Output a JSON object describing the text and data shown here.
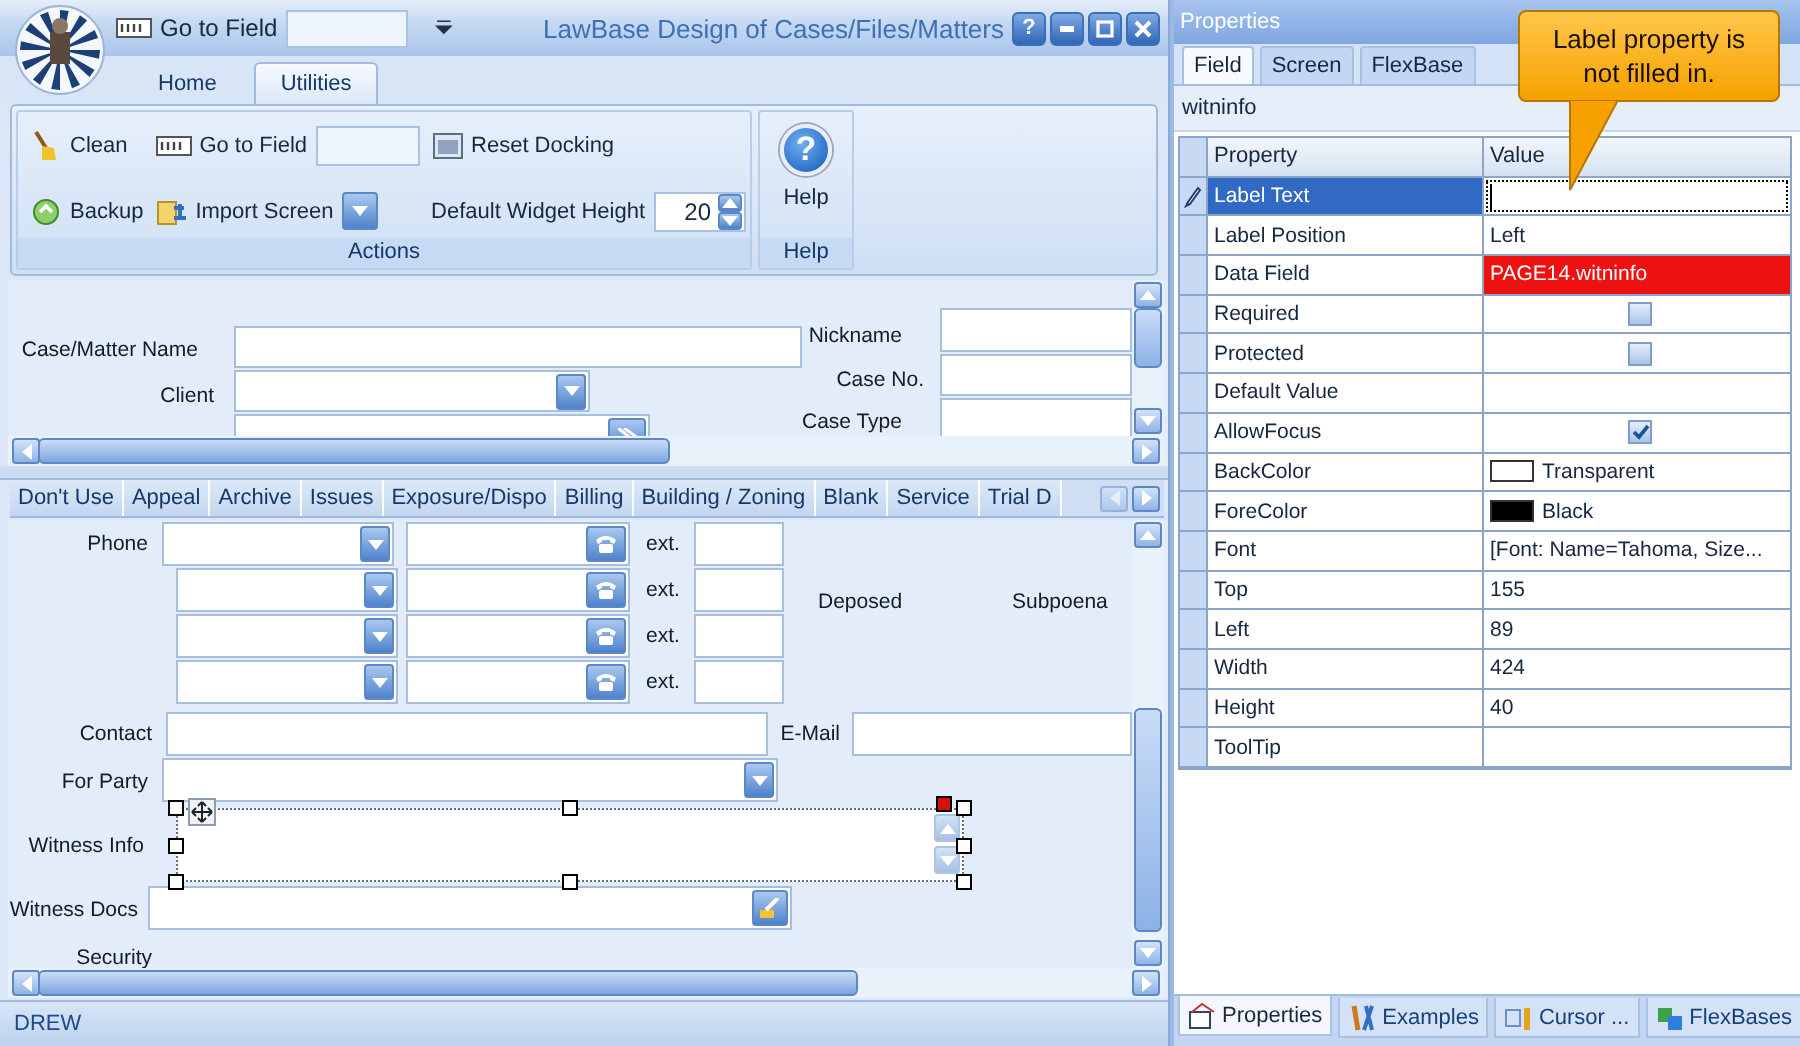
{
  "window": {
    "title": "LawBase Design of Cases/Files/Matters",
    "help_button": "?"
  },
  "quick_access": {
    "label": "Go to Field"
  },
  "ribbon": {
    "tabs": [
      {
        "label": "Home",
        "selected": false
      },
      {
        "label": "Utilities",
        "selected": true
      }
    ],
    "actions": {
      "clean": "Clean",
      "backup": "Backup",
      "go_to_field": "Go to Field",
      "import_screen": "Import Screen",
      "reset_docking": "Reset Docking",
      "widget_height_label": "Default Widget Height",
      "widget_height_value": "20"
    },
    "groups": [
      "Actions",
      "Help"
    ],
    "help": {
      "glyph": "?",
      "label": "Help"
    }
  },
  "case_form": {
    "fields": [
      {
        "label": "Case/Matter Name",
        "kind": "text",
        "selected": false
      },
      {
        "label": "Client",
        "kind": "dropdown",
        "selected": false
      },
      {
        "kind": "lookup",
        "selected": false
      },
      {
        "label": "Nickname",
        "kind": "text",
        "selected": false
      },
      {
        "label": "Case No.",
        "kind": "text",
        "selected": false
      },
      {
        "label": "Case Type",
        "kind": "text",
        "selected": false
      }
    ]
  },
  "section_tabs": [
    {
      "label": "Don't Use",
      "selected": false
    },
    {
      "label": "Appeal",
      "selected": false
    },
    {
      "label": "Archive",
      "selected": false
    },
    {
      "label": "Issues",
      "selected": false
    },
    {
      "label": "Exposure/Dispo",
      "selected": false
    },
    {
      "label": "Billing",
      "selected": false
    },
    {
      "label": "Building / Zoning",
      "selected": false
    },
    {
      "label": "Blank",
      "selected": false
    },
    {
      "label": "Service",
      "selected": false
    },
    {
      "label": "Trial D",
      "selected": false
    }
  ],
  "contact_form": {
    "phones": [
      {
        "label": "Phone",
        "ext_label": "ext."
      },
      {
        "ext_label": "ext."
      },
      {
        "ext_label": "ext."
      },
      {
        "ext_label": "ext."
      }
    ],
    "flags": [
      "Deposed",
      "Subpoena"
    ],
    "fields": [
      {
        "label": "Contact",
        "kind": "text",
        "selected": false
      },
      {
        "label": "E-Mail",
        "kind": "text",
        "selected": false
      },
      {
        "label": "For Party",
        "kind": "dropdown",
        "selected": false
      },
      {
        "label": "Witness Info",
        "kind": "memo",
        "selected": true
      },
      {
        "label": "Witness Docs",
        "kind": "docs",
        "selected": false
      },
      {
        "label": "Security",
        "kind": "label",
        "selected": false
      }
    ]
  },
  "status_bar": {
    "user": "DREW"
  },
  "properties": {
    "title": "Properties",
    "tabs": [
      {
        "label": "Field",
        "selected": true
      },
      {
        "label": "Screen",
        "selected": false
      },
      {
        "label": "FlexBase",
        "selected": false
      }
    ],
    "object": "witninfo",
    "columns": [
      "Property",
      "Value"
    ],
    "rows": [
      {
        "name": "Label Text",
        "kind": "text",
        "selected": true,
        "invalid": false
      },
      {
        "name": "Label Position",
        "kind": "text",
        "value": "Left",
        "selected": false,
        "invalid": false
      },
      {
        "name": "Data Field",
        "kind": "text",
        "value": "PAGE14.witninfo",
        "selected": false,
        "invalid": true
      },
      {
        "name": "Required",
        "kind": "checkbox",
        "checked": false,
        "selected": false,
        "invalid": false
      },
      {
        "name": "Protected",
        "kind": "checkbox",
        "checked": false,
        "selected": false,
        "invalid": false
      },
      {
        "name": "Default Value",
        "kind": "text",
        "selected": false,
        "invalid": false
      },
      {
        "name": "AllowFocus",
        "kind": "checkbox",
        "checked": true,
        "selected": false,
        "invalid": false
      },
      {
        "name": "BackColor",
        "kind": "color",
        "color": "#ffffff",
        "value": "Transparent",
        "selected": false,
        "invalid": false
      },
      {
        "name": "ForeColor",
        "kind": "color",
        "color": "#000000",
        "value": "Black",
        "selected": false,
        "invalid": false
      },
      {
        "name": "Font",
        "kind": "text",
        "value": "[Font: Name=Tahoma, Size...",
        "selected": false,
        "invalid": false
      },
      {
        "name": "Top",
        "kind": "text",
        "value": "155",
        "selected": false,
        "invalid": false
      },
      {
        "name": "Left",
        "kind": "text",
        "value": "89",
        "selected": false,
        "invalid": false
      },
      {
        "name": "Width",
        "kind": "text",
        "value": "424",
        "selected": false,
        "invalid": false
      },
      {
        "name": "Height",
        "kind": "text",
        "value": "40",
        "selected": false,
        "invalid": false
      },
      {
        "name": "ToolTip",
        "kind": "text",
        "selected": false,
        "invalid": false
      }
    ],
    "bottom_tabs": [
      {
        "label": "Properties",
        "selected": true
      },
      {
        "label": "Examples",
        "selected": false
      },
      {
        "label": "Cursor ...",
        "selected": false
      },
      {
        "label": "FlexBases",
        "selected": false
      }
    ]
  },
  "callout": {
    "text": "Label property is not filled in."
  }
}
